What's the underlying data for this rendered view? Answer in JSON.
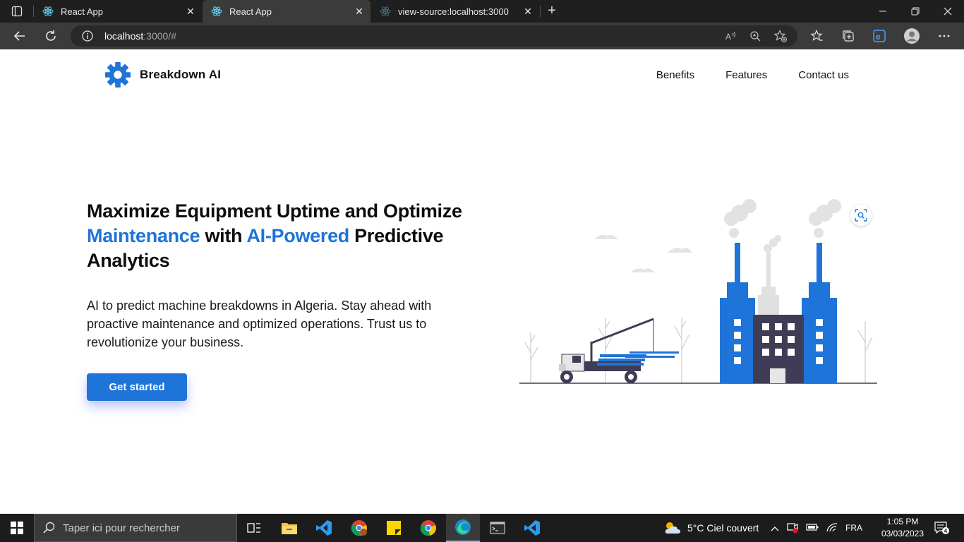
{
  "browser": {
    "tabs": [
      {
        "title": "React App",
        "active": false
      },
      {
        "title": "React App",
        "active": true
      },
      {
        "title": "view-source:localhost:3000",
        "active": false
      }
    ],
    "address": {
      "host": "localhost",
      "path": ":3000/#"
    }
  },
  "site": {
    "brand": "Breakdown AI",
    "nav": [
      "Benefits",
      "Features",
      "Contact us"
    ],
    "hero": {
      "title_part1": "Maximize Equipment Uptime and Optimize",
      "title_blue1": "Maintenance",
      "title_part2": " with ",
      "title_blue2": "AI-Powered",
      "title_part3": " Predictive Analytics",
      "description": "AI to predict machine breakdowns in Algeria. Stay ahead with proactive maintenance and optimized operations. Trust us to revolutionize your business.",
      "cta": "Get started"
    },
    "accent_color": "#1e74d8"
  },
  "taskbar": {
    "search_placeholder": "Taper ici pour rechercher",
    "weather": "5°C  Ciel couvert",
    "language": "FRA",
    "time": "1:05 PM",
    "date": "03/03/2023",
    "notifications": "4"
  }
}
